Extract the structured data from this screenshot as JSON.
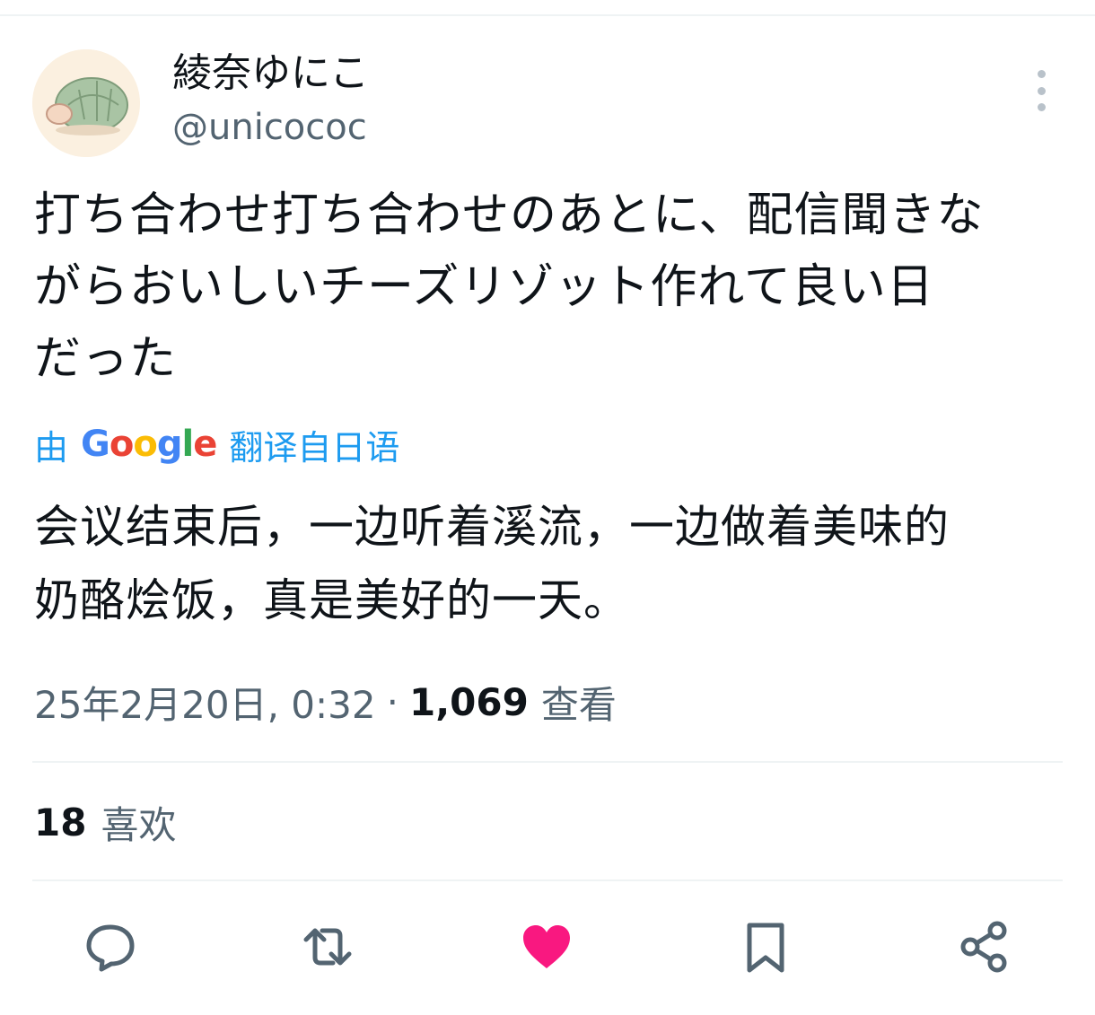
{
  "author": {
    "display_name": "綾奈ゆにこ",
    "handle": "@unicococ"
  },
  "tweet": {
    "text": "打ち合わせ打ち合わせのあとに、配信聞きな\nがらおいしいチーズリゾット作れて良い日\nだった"
  },
  "translation": {
    "by": "由",
    "google": [
      "G",
      "o",
      "o",
      "g",
      "l",
      "e"
    ],
    "suffix": "翻译自日语",
    "text": "会议结束后，一边听着溪流，一边做着美味的\n奶酪烩饭，真是美好的一天。"
  },
  "meta": {
    "datetime": "25年2月20日, 0:32",
    "separator": "·",
    "views_count": "1,069",
    "views_label": "查看"
  },
  "stats": {
    "likes_count": "18",
    "likes_label": "喜欢"
  },
  "actions": {
    "reply_icon": "reply-icon",
    "retweet_icon": "retweet-icon",
    "like_icon": "heart-filled-icon",
    "bookmark_icon": "bookmark-icon",
    "share_icon": "share-icon"
  },
  "colors": {
    "accent": "#1d9bf0",
    "like": "#f91880",
    "secondary_text": "#536471",
    "icon": "#536471"
  }
}
